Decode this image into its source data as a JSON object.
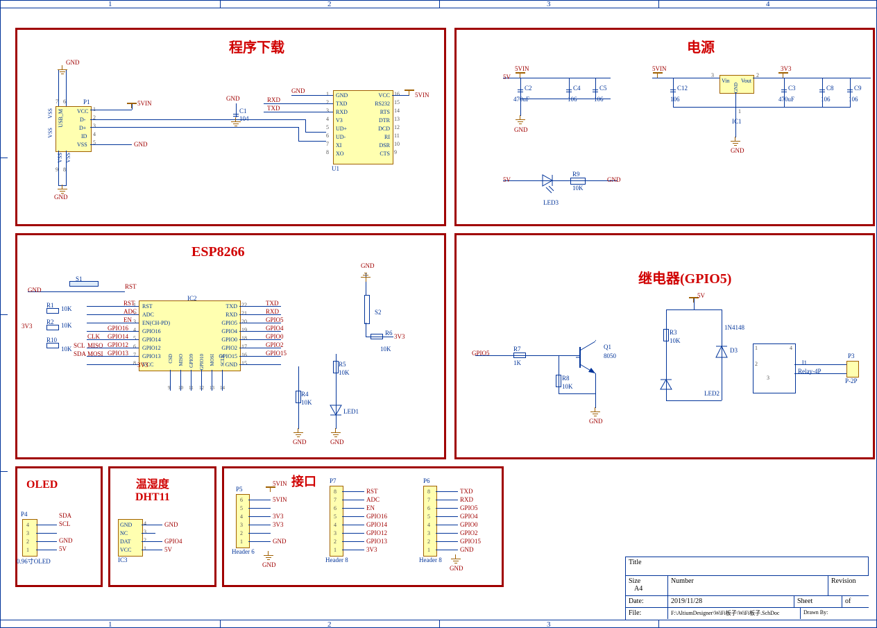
{
  "border": {
    "cols": [
      "1",
      "2",
      "3",
      "4"
    ]
  },
  "blocks": {
    "prog": {
      "title": "程序下载"
    },
    "power": {
      "title": "电源"
    },
    "esp": {
      "title": "ESP8266"
    },
    "relay": {
      "title": "继电器(GPIO5)"
    },
    "oled": {
      "title": "OLED"
    },
    "dht": {
      "title": "温湿度\nDHT11"
    },
    "iface": {
      "title": "接口"
    }
  },
  "prog": {
    "usb": {
      "desig": "P1",
      "type": "USB_M",
      "pins": [
        "VCC",
        "D-",
        "D+",
        "ID",
        "VSS"
      ],
      "shell": [
        "VSS",
        "VSS",
        "VSS",
        "VSS"
      ],
      "shellnums": [
        "7",
        "6",
        "9",
        "8"
      ],
      "pinnums": [
        "1",
        "2",
        "3",
        "4",
        "5"
      ]
    },
    "u1": {
      "desig": "U1",
      "left": [
        "GND",
        "TXD",
        "RXD",
        "V3",
        "UD+",
        "UD-",
        "XI",
        "XO"
      ],
      "lnums": [
        "1",
        "2",
        "3",
        "4",
        "5",
        "6",
        "7",
        "8"
      ],
      "right": [
        "VCC",
        "RS232",
        "RTS",
        "DTR",
        "DCD",
        "RI",
        "DSR",
        "CTS"
      ],
      "rnums": [
        "16",
        "15",
        "14",
        "13",
        "12",
        "11",
        "10",
        "9"
      ]
    },
    "nets": {
      "gnd": "GND",
      "n5v": "5VIN",
      "rxd": "RXD",
      "txd": "TXD"
    },
    "c1": {
      "desig": "C1",
      "val": "104"
    }
  },
  "power": {
    "ic1": {
      "desig": "IC1",
      "pins": {
        "vin": "Vin",
        "vout": "Vout",
        "gnd": "GND"
      },
      "pinnums": {
        "vin": "3",
        "vout": "2",
        "gnd": "1"
      }
    },
    "caps": [
      {
        "desig": "C2",
        "val": "470uF"
      },
      {
        "desig": "C4",
        "val": "106"
      },
      {
        "desig": "C5",
        "val": "106"
      },
      {
        "desig": "C12",
        "val": "106"
      },
      {
        "desig": "C3",
        "val": "470uF"
      },
      {
        "desig": "C8",
        "val": "106"
      },
      {
        "desig": "C9",
        "val": "106"
      }
    ],
    "nets": {
      "n5v": "5V",
      "n5vin": "5VIN",
      "n3v3": "3V3",
      "gnd": "GND"
    },
    "led": {
      "desig": "LED3",
      "r": {
        "desig": "R9",
        "val": "10K"
      }
    }
  },
  "esp": {
    "ic2": {
      "desig": "IC2",
      "left": [
        "RST",
        "ADC",
        "EN(CH-PD)",
        "GPIO16",
        "GPIO14",
        "GPIO12",
        "GPIO13",
        "VCC"
      ],
      "lnums": [
        "1",
        "2",
        "3",
        "4",
        "5",
        "6",
        "7",
        "8"
      ],
      "right": [
        "TXD",
        "RXD",
        "GPIO5",
        "GPIO4",
        "GPIO0",
        "GPIO2",
        "GPIO15",
        "GND"
      ],
      "rnums": [
        "22",
        "21",
        "20",
        "19",
        "18",
        "17",
        "16",
        "15"
      ],
      "bottom": [
        "CSD",
        "MISO",
        "GPIO9",
        "GPIO10",
        "MOSI",
        "SCLK"
      ],
      "bnums": [
        "9",
        "10",
        "11",
        "12",
        "13",
        "14"
      ]
    },
    "nets": {
      "rst": "RST",
      "adc": "ADC",
      "en": "EN",
      "g16": "GPIO16",
      "g14": "GPIO14",
      "g12": "GPIO12",
      "g13": "GPIO13",
      "txd": "TXD",
      "rxd": "RXD",
      "g5": "GPIO5",
      "g4": "GPIO4",
      "g0": "GPIO0",
      "g2": "GPIO2",
      "g15": "GPIO15",
      "clk": "CLK",
      "miso": "MISO",
      "mosi": "MOSI",
      "sda": "SDA",
      "scl": "SCL",
      "g3v3": "3V3",
      "gnd": "GND"
    },
    "r": [
      {
        "desig": "R1",
        "val": "10K"
      },
      {
        "desig": "R2",
        "val": "10K"
      },
      {
        "desig": "R10",
        "val": "10K"
      },
      {
        "desig": "R4",
        "val": "10K"
      },
      {
        "desig": "R5",
        "val": "10K"
      },
      {
        "desig": "R6",
        "val": "10K"
      }
    ],
    "sw": [
      {
        "desig": "S1"
      },
      {
        "desig": "S2"
      }
    ],
    "led": {
      "desig": "LED1"
    }
  },
  "relay": {
    "nets": {
      "g5": "GPIO5",
      "n5v": "5V",
      "gnd": "GND"
    },
    "r": [
      {
        "desig": "R7",
        "val": "1K"
      },
      {
        "desig": "R8",
        "val": "10K"
      },
      {
        "desig": "R3",
        "val": "10K"
      }
    ],
    "q": {
      "desig": "Q1",
      "val": "8050"
    },
    "d": {
      "desig": "D3",
      "val": "1N4148"
    },
    "led": {
      "desig": "LED2"
    },
    "j": {
      "desig": "J1",
      "val": "Relay-4P",
      "pins": [
        "1",
        "2",
        "3",
        "4"
      ]
    },
    "p": {
      "desig": "P3",
      "val": "P-2P"
    }
  },
  "oled": {
    "desig": "P4",
    "type": "0.96寸OLED",
    "pins": [
      "4",
      "3",
      "2",
      "1"
    ],
    "nets": [
      "SDA",
      "SCL",
      "GND",
      "5V"
    ]
  },
  "dht": {
    "desig": "IC3",
    "pins": [
      "GND",
      "NC",
      "DAT",
      "VCC"
    ],
    "pinnums": [
      "4",
      "3",
      "2",
      "1"
    ],
    "nets": [
      "GND",
      "",
      "GPIO4",
      "5V"
    ]
  },
  "iface": {
    "p5": {
      "desig": "P5",
      "type": "Header 6",
      "pins": [
        "6",
        "5",
        "4",
        "3",
        "2",
        "1"
      ],
      "nets": [
        "5VIN",
        "",
        "3V3",
        "3V3",
        "",
        "GND"
      ]
    },
    "p7": {
      "desig": "P7",
      "type": "Header 8",
      "pins": [
        "8",
        "7",
        "6",
        "5",
        "4",
        "3",
        "2",
        "1"
      ],
      "nets": [
        "RST",
        "ADC",
        "EN",
        "GPIO16",
        "GPIO14",
        "GPIO12",
        "GPIO13",
        "3V3"
      ]
    },
    "p6": {
      "desig": "P6",
      "type": "Header 8",
      "pins": [
        "8",
        "7",
        "6",
        "5",
        "4",
        "3",
        "2",
        "1"
      ],
      "nets": [
        "TXD",
        "RXD",
        "GPIO5",
        "GPIO4",
        "GPIO0",
        "GPIO2",
        "GPIO15",
        "GND"
      ]
    }
  },
  "titleblock": {
    "title": "Title",
    "size": "Size",
    "sizeval": "A4",
    "number": "Number",
    "revision": "Revision",
    "date": "Date:",
    "dateval": "2019/11/28",
    "sheet": "Sheet",
    "of": "of",
    "file": "File:",
    "fileval": "F:\\AltiumDesigner\\WiFi板子\\WiFi板子.SchDoc",
    "drawn": "Drawn By:"
  }
}
